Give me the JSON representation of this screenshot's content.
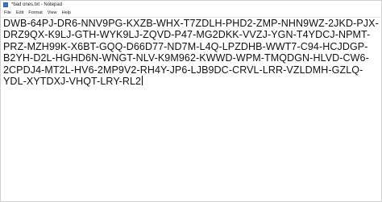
{
  "window": {
    "title": "*bad ones.txt - Notepad",
    "icon": "notepad-icon"
  },
  "menubar": {
    "items": [
      "File",
      "Edit",
      "Format",
      "View",
      "Help"
    ]
  },
  "editor": {
    "lines": [
      "DWB-64PJ-DR6-NNV9PG-KXZB-WHX-T7ZDLH-PHD2-ZMP-NHN9WZ-2JKD-PJX-",
      "DRZ9QX-K9LJ-GTH-WYK9LJ-ZQVD-P47-MG2DKK-VVZJ-YGN-T4YDCJ-NPMT-",
      "PRZ-MZH99K-X6BT-GQQ-D66D77-ND7M-L4Q-LPZDHB-WWT7-C94-HCJDGP-",
      "B2YH-D2L-HGHD6N-WNGT-NLV-K9M962-KWWD-WPM-TMQDGN-HLVD-CW6-",
      "2CPDJ4-MT2L-HV6-2MP9V2-RH4Y-JP6-LJB9DC-CRVL-LRR-VZLDMH-GZLQ-",
      "YDL-XYTDXJ-VHQT-LRY-RL2"
    ]
  }
}
